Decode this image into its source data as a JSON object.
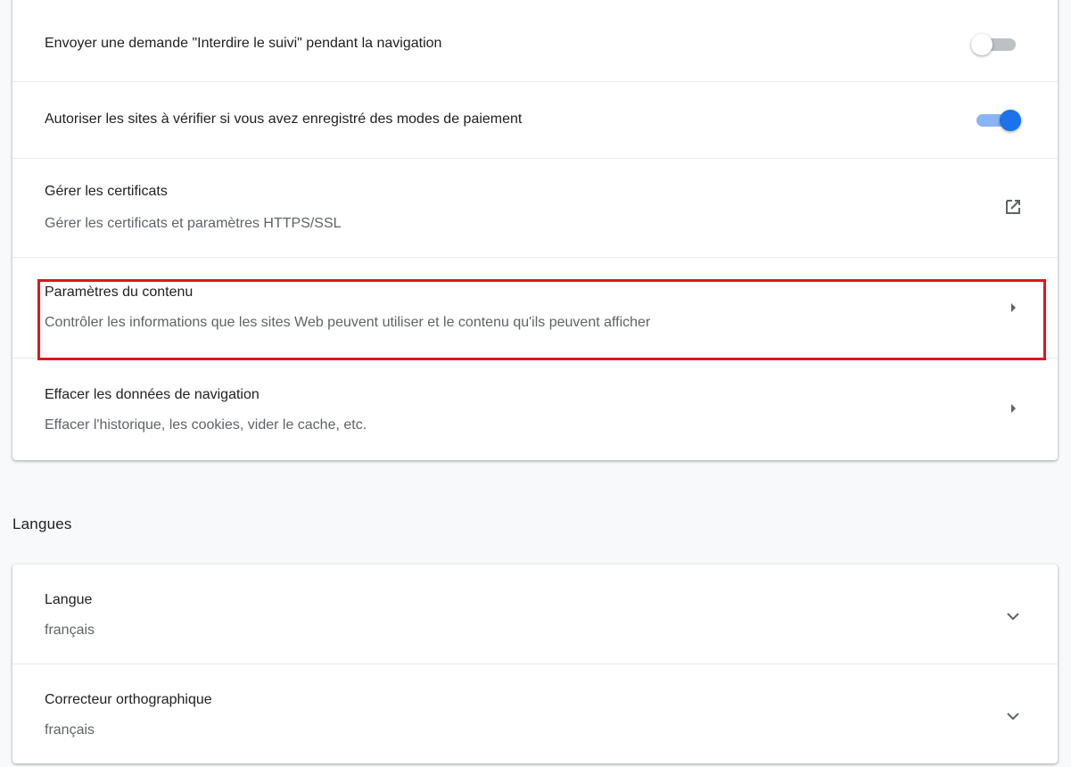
{
  "privacy": {
    "do_not_track": {
      "label": "Envoyer une demande \"Interdire le suivi\" pendant la navigation",
      "enabled": false
    },
    "payment_methods": {
      "label": "Autoriser les sites à vérifier si vous avez enregistré des modes de paiement",
      "enabled": true
    },
    "certificates": {
      "label": "Gérer les certificats",
      "sublabel": "Gérer les certificats et paramètres HTTPS/SSL",
      "icon": "open-in-new-icon"
    },
    "content_settings": {
      "label": "Paramètres du contenu",
      "sublabel": "Contrôler les informations que les sites Web peuvent utiliser et le contenu qu'ils peuvent afficher",
      "icon": "arrow-right-icon"
    },
    "clear_data": {
      "label": "Effacer les données de navigation",
      "sublabel": "Effacer l'historique, les cookies, vider le cache, etc.",
      "icon": "arrow-right-icon"
    }
  },
  "languages": {
    "section_title": "Langues",
    "language": {
      "label": "Langue",
      "value": "français",
      "icon": "expand-more-icon"
    },
    "spellcheck": {
      "label": "Correcteur orthographique",
      "value": "français",
      "icon": "expand-more-icon"
    }
  },
  "colors": {
    "accent": "#1a73e8",
    "accent_light": "#8ab4f8",
    "highlight_border": "#e2141f"
  }
}
